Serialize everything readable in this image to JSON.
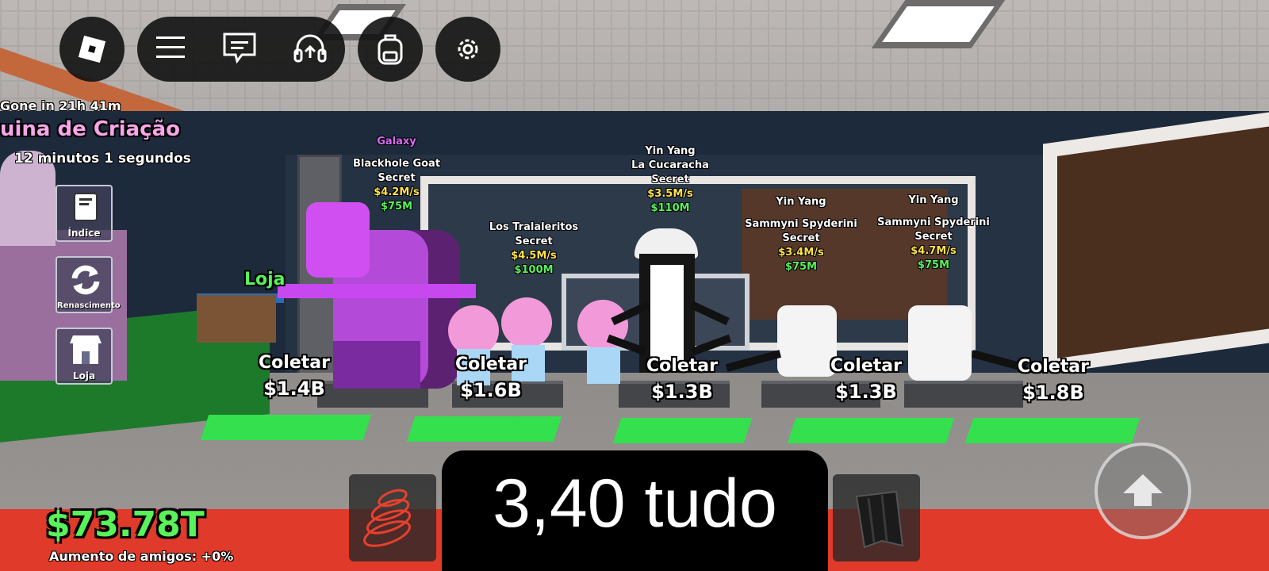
{
  "hud": {
    "timer_line": "Gone in 21h 41m",
    "event_title": "uina de Criação",
    "countdown": "12 minutos 1 segundos",
    "money": "$73.78T",
    "friends_boost": "Aumento de amigos: +0%",
    "center_text": "3,40 tudo",
    "shop_world_label": "Loja"
  },
  "top_bar": {
    "buttons": [
      "roblox-logo-icon",
      "menu-icon",
      "chat-icon",
      "headset-icon",
      "backpack-icon",
      "gear-icon"
    ]
  },
  "side_menu": [
    {
      "label": "Índice",
      "icon": "book-icon"
    },
    {
      "label": "Renascimento",
      "icon": "refresh-icon"
    },
    {
      "label": "Loja",
      "icon": "store-icon"
    }
  ],
  "brainrots": [
    {
      "mutation": "Galaxy",
      "name": "Blackhole Goat",
      "rarity": "Secret",
      "rate": "$4.2M/s",
      "price": "$75M"
    },
    {
      "mutation": "",
      "name": "Los Tralaleritos",
      "rarity": "Secret",
      "rate": "$4.5M/s",
      "price": "$100M"
    },
    {
      "mutation": "Yin Yang",
      "name": "La Cucaracha",
      "rarity": "Secret",
      "rate": "$3.5M/s",
      "price": "$110M"
    },
    {
      "mutation": "Yin Yang",
      "name": "Sammyni Spyderini",
      "rarity": "Secret",
      "rate": "$3.4M/s",
      "price": "$75M"
    },
    {
      "mutation": "Yin Yang",
      "name": "Sammyni Spyderini",
      "rarity": "Secret",
      "rate": "$4.7M/s",
      "price": "$75M"
    }
  ],
  "collect_pads": [
    {
      "label": "Coletar",
      "amount": "$1.4B"
    },
    {
      "label": "Coletar",
      "amount": "$1.6B"
    },
    {
      "label": "Coletar",
      "amount": "$1.3B"
    },
    {
      "label": "Coletar",
      "amount": "$1.3B"
    },
    {
      "label": "Coletar",
      "amount": "$1.8B"
    }
  ],
  "hotbar": [
    {
      "icon": "coil-icon"
    },
    {
      "icon": "cape-icon"
    }
  ],
  "colors": {
    "money_green": "#58f25a",
    "rate_yellow": "#ffe14a",
    "galaxy_magenta": "#d86af7",
    "event_pink": "#f7a6e8",
    "pad_green": "#34e04e"
  }
}
